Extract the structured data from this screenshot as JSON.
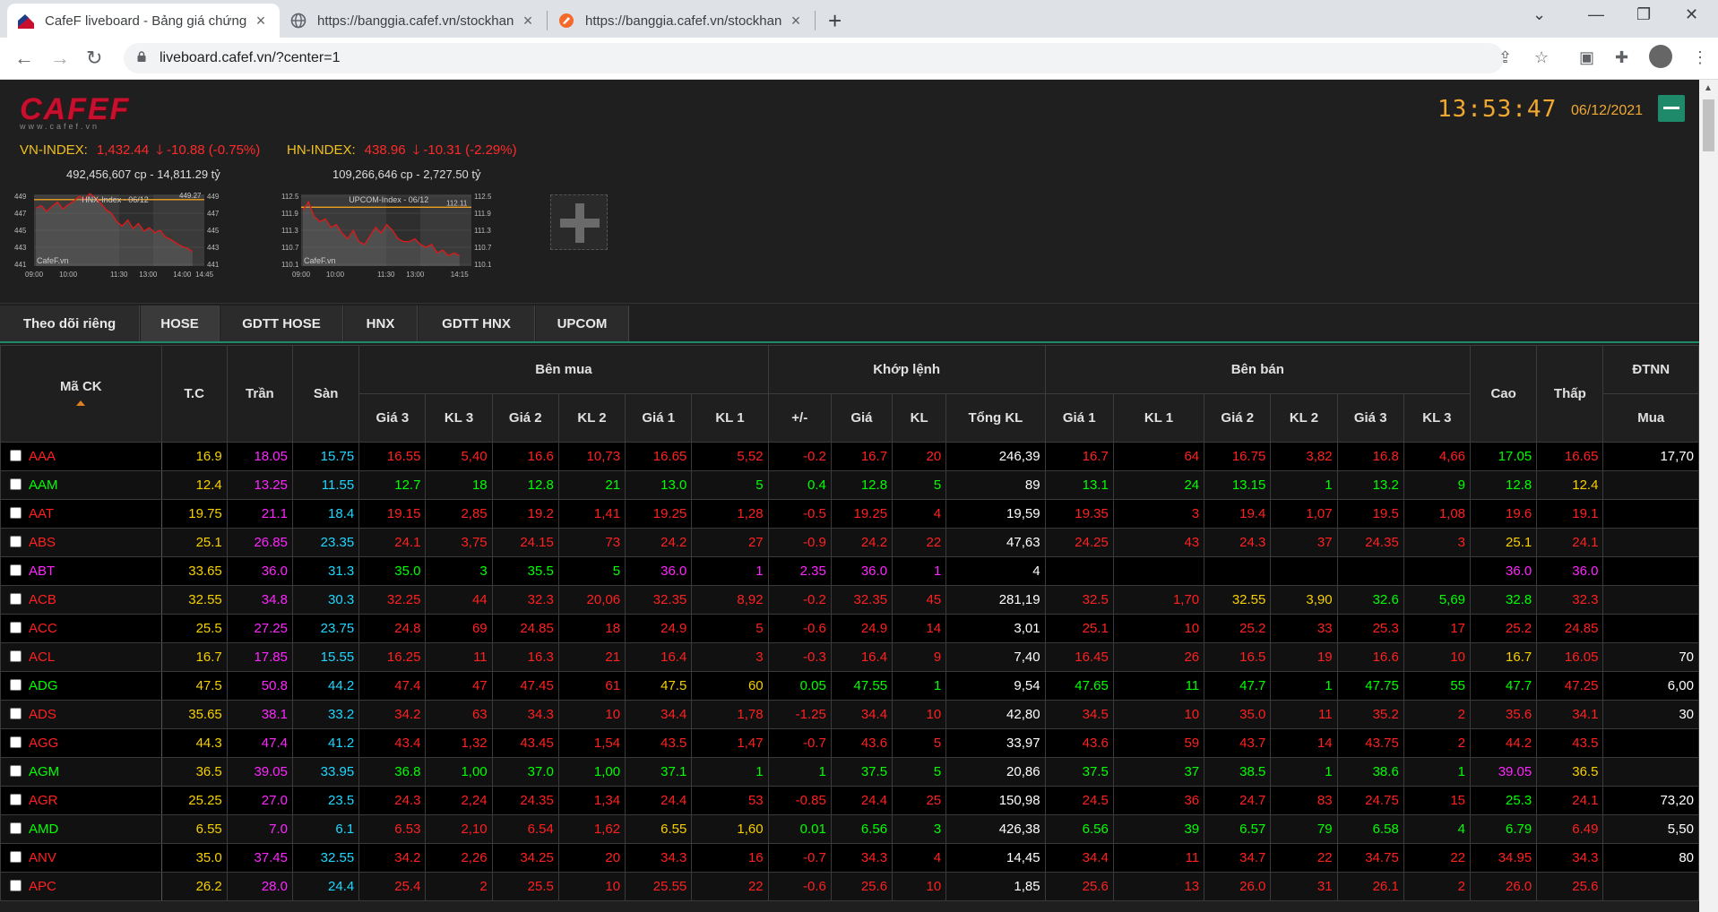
{
  "browser": {
    "tabs": [
      {
        "title": "CafeF liveboard - Bảng giá chứng",
        "active": true
      },
      {
        "title": "https://banggia.cafef.vn/stockhan",
        "active": false
      },
      {
        "title": "https://banggia.cafef.vn/stockhan",
        "active": false
      }
    ],
    "url": "liveboard.cafef.vn/?center=1"
  },
  "header": {
    "logo_text": "CAFEF",
    "logo_sub": "www.cafef.vn",
    "time": "13:53:47",
    "date": "06/12/2021"
  },
  "indices": [
    {
      "name": "VN-INDEX:",
      "value": "1,432.44",
      "change": "-10.88 (-0.75%)",
      "volume": "492,456,607 cp - 14,811.29 tỷ"
    },
    {
      "name": "HN-INDEX:",
      "value": "438.96",
      "change": "-10.31 (-2.29%)",
      "volume": "109,266,646 cp - 2,727.50 tỷ"
    }
  ],
  "charts": [
    {
      "title": "HNX-Index - 06/12",
      "ref_label": "449.27",
      "y_ticks": [
        "449",
        "447",
        "445",
        "443",
        "441"
      ],
      "x_ticks": [
        "09:00",
        "10:00",
        "11:30",
        "13:00",
        "14:00",
        "14:45"
      ],
      "watermark": "CafeF.vn",
      "series": [
        447.6,
        447.9,
        447.2,
        447.8,
        448.3,
        447.5,
        448.0,
        448.4,
        449.0,
        448.6,
        449.3,
        448.8,
        448.2,
        447.4,
        447.0,
        446.0,
        445.5,
        446.2,
        445.2,
        445.8,
        444.9,
        445.3,
        444.7,
        445.0,
        444.2,
        443.9,
        443.5,
        443.1,
        442.9,
        442.5
      ]
    },
    {
      "title": "UPCOM-Index - 06/12",
      "ref_label": "112.11",
      "y_ticks": [
        "112.5",
        "111.9",
        "111.3",
        "110.7",
        "110.1"
      ],
      "x_ticks": [
        "09:00",
        "10:00",
        "11:30",
        "13:00",
        "14:15"
      ],
      "watermark": "CafeF.vn",
      "series": [
        112.0,
        112.3,
        111.8,
        111.6,
        111.7,
        111.4,
        111.5,
        111.2,
        111.0,
        111.3,
        110.9,
        110.8,
        111.1,
        111.4,
        111.2,
        111.5,
        111.3,
        111.0,
        110.9,
        110.9,
        111.0,
        110.8,
        110.7,
        110.8,
        110.5,
        110.6,
        110.4,
        110.5,
        110.4
      ]
    }
  ],
  "colors": {
    "up": "#00ff00",
    "down": "#ff2020",
    "ref": "#f7d000",
    "ceiling": "#ff25ff",
    "floor": "#1ed7ff",
    "accent": "#1e8a6a"
  },
  "page_tabs": [
    {
      "label": "Theo dõi riêng",
      "active": false
    },
    {
      "label": "HOSE",
      "active": true
    },
    {
      "label": "GDTT HOSE",
      "active": false
    },
    {
      "label": "HNX",
      "active": false
    },
    {
      "label": "GDTT HNX",
      "active": false
    },
    {
      "label": "UPCOM",
      "active": false
    }
  ],
  "table": {
    "group_headers": {
      "symbol": "Mã CK",
      "ref": "T.C",
      "ceiling": "Trần",
      "floor": "Sàn",
      "buy": "Bên mua",
      "match": "Khớp lệnh",
      "sell": "Bên bán",
      "high": "Cao",
      "low": "Thấp",
      "foreign": "ĐTNN"
    },
    "sub_headers": [
      "Giá 3",
      "KL 3",
      "Giá 2",
      "KL 2",
      "Giá 1",
      "KL 1",
      "+/-",
      "Giá",
      "KL",
      "Tổng KL",
      "Giá 1",
      "KL 1",
      "Giá 2",
      "KL 2",
      "Giá 3",
      "KL 3",
      "Mua"
    ],
    "rows": [
      {
        "sym": "AAA",
        "tc": "16.9",
        "tran": "18.05",
        "san": "15.75",
        "b3": "16.55",
        "bk3": "5,40",
        "b2": "16.6",
        "bk2": "10,73",
        "b1": "16.65",
        "bk1": "5,52",
        "chg": "-0.2",
        "p": "16.7",
        "kl": "20",
        "tot": "246,39",
        "s1": "16.7",
        "sk1": "64",
        "s2": "16.75",
        "sk2": "3,82",
        "s3": "16.8",
        "sk3": "4,66",
        "hi": "17.05",
        "lo": "16.65",
        "nn": "17,70"
      },
      {
        "sym": "AAM",
        "tc": "12.4",
        "tran": "13.25",
        "san": "11.55",
        "b3": "12.7",
        "bk3": "18",
        "b2": "12.8",
        "bk2": "21",
        "b1": "13.0",
        "bk1": "5",
        "chg": "0.4",
        "p": "12.8",
        "kl": "5",
        "tot": "89",
        "s1": "13.1",
        "sk1": "24",
        "s2": "13.15",
        "sk2": "1",
        "s3": "13.2",
        "sk3": "9",
        "hi": "12.8",
        "lo": "12.4",
        "nn": ""
      },
      {
        "sym": "AAT",
        "tc": "19.75",
        "tran": "21.1",
        "san": "18.4",
        "b3": "19.15",
        "bk3": "2,85",
        "b2": "19.2",
        "bk2": "1,41",
        "b1": "19.25",
        "bk1": "1,28",
        "chg": "-0.5",
        "p": "19.25",
        "kl": "4",
        "tot": "19,59",
        "s1": "19.35",
        "sk1": "3",
        "s2": "19.4",
        "sk2": "1,07",
        "s3": "19.5",
        "sk3": "1,08",
        "hi": "19.6",
        "lo": "19.1",
        "nn": ""
      },
      {
        "sym": "ABS",
        "tc": "25.1",
        "tran": "26.85",
        "san": "23.35",
        "b3": "24.1",
        "bk3": "3,75",
        "b2": "24.15",
        "bk2": "73",
        "b1": "24.2",
        "bk1": "27",
        "chg": "-0.9",
        "p": "24.2",
        "kl": "22",
        "tot": "47,63",
        "s1": "24.25",
        "sk1": "43",
        "s2": "24.3",
        "sk2": "37",
        "s3": "24.35",
        "sk3": "3",
        "hi": "25.1",
        "lo": "24.1",
        "nn": ""
      },
      {
        "sym": "ABT",
        "tc": "33.65",
        "tran": "36.0",
        "san": "31.3",
        "b3": "35.0",
        "bk3": "3",
        "b2": "35.5",
        "bk2": "5",
        "b1": "36.0",
        "bk1": "1",
        "chg": "2.35",
        "p": "36.0",
        "kl": "1",
        "tot": "4",
        "s1": "",
        "sk1": "",
        "s2": "",
        "sk2": "",
        "s3": "",
        "sk3": "",
        "hi": "36.0",
        "lo": "36.0",
        "nn": ""
      },
      {
        "sym": "ACB",
        "tc": "32.55",
        "tran": "34.8",
        "san": "30.3",
        "b3": "32.25",
        "bk3": "44",
        "b2": "32.3",
        "bk2": "20,06",
        "b1": "32.35",
        "bk1": "8,92",
        "chg": "-0.2",
        "p": "32.35",
        "kl": "45",
        "tot": "281,19",
        "s1": "32.5",
        "sk1": "1,70",
        "s2": "32.55",
        "sk2": "3,90",
        "s3": "32.6",
        "sk3": "5,69",
        "hi": "32.8",
        "lo": "32.3",
        "nn": ""
      },
      {
        "sym": "ACC",
        "tc": "25.5",
        "tran": "27.25",
        "san": "23.75",
        "b3": "24.8",
        "bk3": "69",
        "b2": "24.85",
        "bk2": "18",
        "b1": "24.9",
        "bk1": "5",
        "chg": "-0.6",
        "p": "24.9",
        "kl": "14",
        "tot": "3,01",
        "s1": "25.1",
        "sk1": "10",
        "s2": "25.2",
        "sk2": "33",
        "s3": "25.3",
        "sk3": "17",
        "hi": "25.2",
        "lo": "24.85",
        "nn": ""
      },
      {
        "sym": "ACL",
        "tc": "16.7",
        "tran": "17.85",
        "san": "15.55",
        "b3": "16.25",
        "bk3": "11",
        "b2": "16.3",
        "bk2": "21",
        "b1": "16.4",
        "bk1": "3",
        "chg": "-0.3",
        "p": "16.4",
        "kl": "9",
        "tot": "7,40",
        "s1": "16.45",
        "sk1": "26",
        "s2": "16.5",
        "sk2": "19",
        "s3": "16.6",
        "sk3": "10",
        "hi": "16.7",
        "lo": "16.05",
        "nn": "70"
      },
      {
        "sym": "ADG",
        "tc": "47.5",
        "tran": "50.8",
        "san": "44.2",
        "b3": "47.4",
        "bk3": "47",
        "b2": "47.45",
        "bk2": "61",
        "b1": "47.5",
        "bk1": "60",
        "chg": "0.05",
        "p": "47.55",
        "kl": "1",
        "tot": "9,54",
        "s1": "47.65",
        "sk1": "11",
        "s2": "47.7",
        "sk2": "1",
        "s3": "47.75",
        "sk3": "55",
        "hi": "47.7",
        "lo": "47.25",
        "nn": "6,00"
      },
      {
        "sym": "ADS",
        "tc": "35.65",
        "tran": "38.1",
        "san": "33.2",
        "b3": "34.2",
        "bk3": "63",
        "b2": "34.3",
        "bk2": "10",
        "b1": "34.4",
        "bk1": "1,78",
        "chg": "-1.25",
        "p": "34.4",
        "kl": "10",
        "tot": "42,80",
        "s1": "34.5",
        "sk1": "10",
        "s2": "35.0",
        "sk2": "11",
        "s3": "35.2",
        "sk3": "2",
        "hi": "35.6",
        "lo": "34.1",
        "nn": "30"
      },
      {
        "sym": "AGG",
        "tc": "44.3",
        "tran": "47.4",
        "san": "41.2",
        "b3": "43.4",
        "bk3": "1,32",
        "b2": "43.45",
        "bk2": "1,54",
        "b1": "43.5",
        "bk1": "1,47",
        "chg": "-0.7",
        "p": "43.6",
        "kl": "5",
        "tot": "33,97",
        "s1": "43.6",
        "sk1": "59",
        "s2": "43.7",
        "sk2": "14",
        "s3": "43.75",
        "sk3": "2",
        "hi": "44.2",
        "lo": "43.5",
        "nn": ""
      },
      {
        "sym": "AGM",
        "tc": "36.5",
        "tran": "39.05",
        "san": "33.95",
        "b3": "36.8",
        "bk3": "1,00",
        "b2": "37.0",
        "bk2": "1,00",
        "b1": "37.1",
        "bk1": "1",
        "chg": "1",
        "p": "37.5",
        "kl": "5",
        "tot": "20,86",
        "s1": "37.5",
        "sk1": "37",
        "s2": "38.5",
        "sk2": "1",
        "s3": "38.6",
        "sk3": "1",
        "hi": "39.05",
        "lo": "36.5",
        "nn": ""
      },
      {
        "sym": "AGR",
        "tc": "25.25",
        "tran": "27.0",
        "san": "23.5",
        "b3": "24.3",
        "bk3": "2,24",
        "b2": "24.35",
        "bk2": "1,34",
        "b1": "24.4",
        "bk1": "53",
        "chg": "-0.85",
        "p": "24.4",
        "kl": "25",
        "tot": "150,98",
        "s1": "24.5",
        "sk1": "36",
        "s2": "24.7",
        "sk2": "83",
        "s3": "24.75",
        "sk3": "15",
        "hi": "25.3",
        "lo": "24.1",
        "nn": "73,20"
      },
      {
        "sym": "AMD",
        "tc": "6.55",
        "tran": "7.0",
        "san": "6.1",
        "b3": "6.53",
        "bk3": "2,10",
        "b2": "6.54",
        "bk2": "1,62",
        "b1": "6.55",
        "bk1": "1,60",
        "chg": "0.01",
        "p": "6.56",
        "kl": "3",
        "tot": "426,38",
        "s1": "6.56",
        "sk1": "39",
        "s2": "6.57",
        "sk2": "79",
        "s3": "6.58",
        "sk3": "4",
        "hi": "6.79",
        "lo": "6.49",
        "nn": "5,50"
      },
      {
        "sym": "ANV",
        "tc": "35.0",
        "tran": "37.45",
        "san": "32.55",
        "b3": "34.2",
        "bk3": "2,26",
        "b2": "34.25",
        "bk2": "20",
        "b1": "34.3",
        "bk1": "16",
        "chg": "-0.7",
        "p": "34.3",
        "kl": "4",
        "tot": "14,45",
        "s1": "34.4",
        "sk1": "11",
        "s2": "34.7",
        "sk2": "22",
        "s3": "34.75",
        "sk3": "22",
        "hi": "34.95",
        "lo": "34.3",
        "nn": "80"
      },
      {
        "sym": "APC",
        "tc": "26.2",
        "tran": "28.0",
        "san": "24.4",
        "b3": "25.4",
        "bk3": "2",
        "b2": "25.5",
        "bk2": "10",
        "b1": "25.55",
        "bk1": "22",
        "chg": "-0.6",
        "p": "25.6",
        "kl": "10",
        "tot": "1,85",
        "s1": "25.6",
        "sk1": "13",
        "s2": "26.0",
        "sk2": "31",
        "s3": "26.1",
        "sk3": "2",
        "hi": "26.0",
        "lo": "25.6",
        "nn": ""
      }
    ]
  }
}
